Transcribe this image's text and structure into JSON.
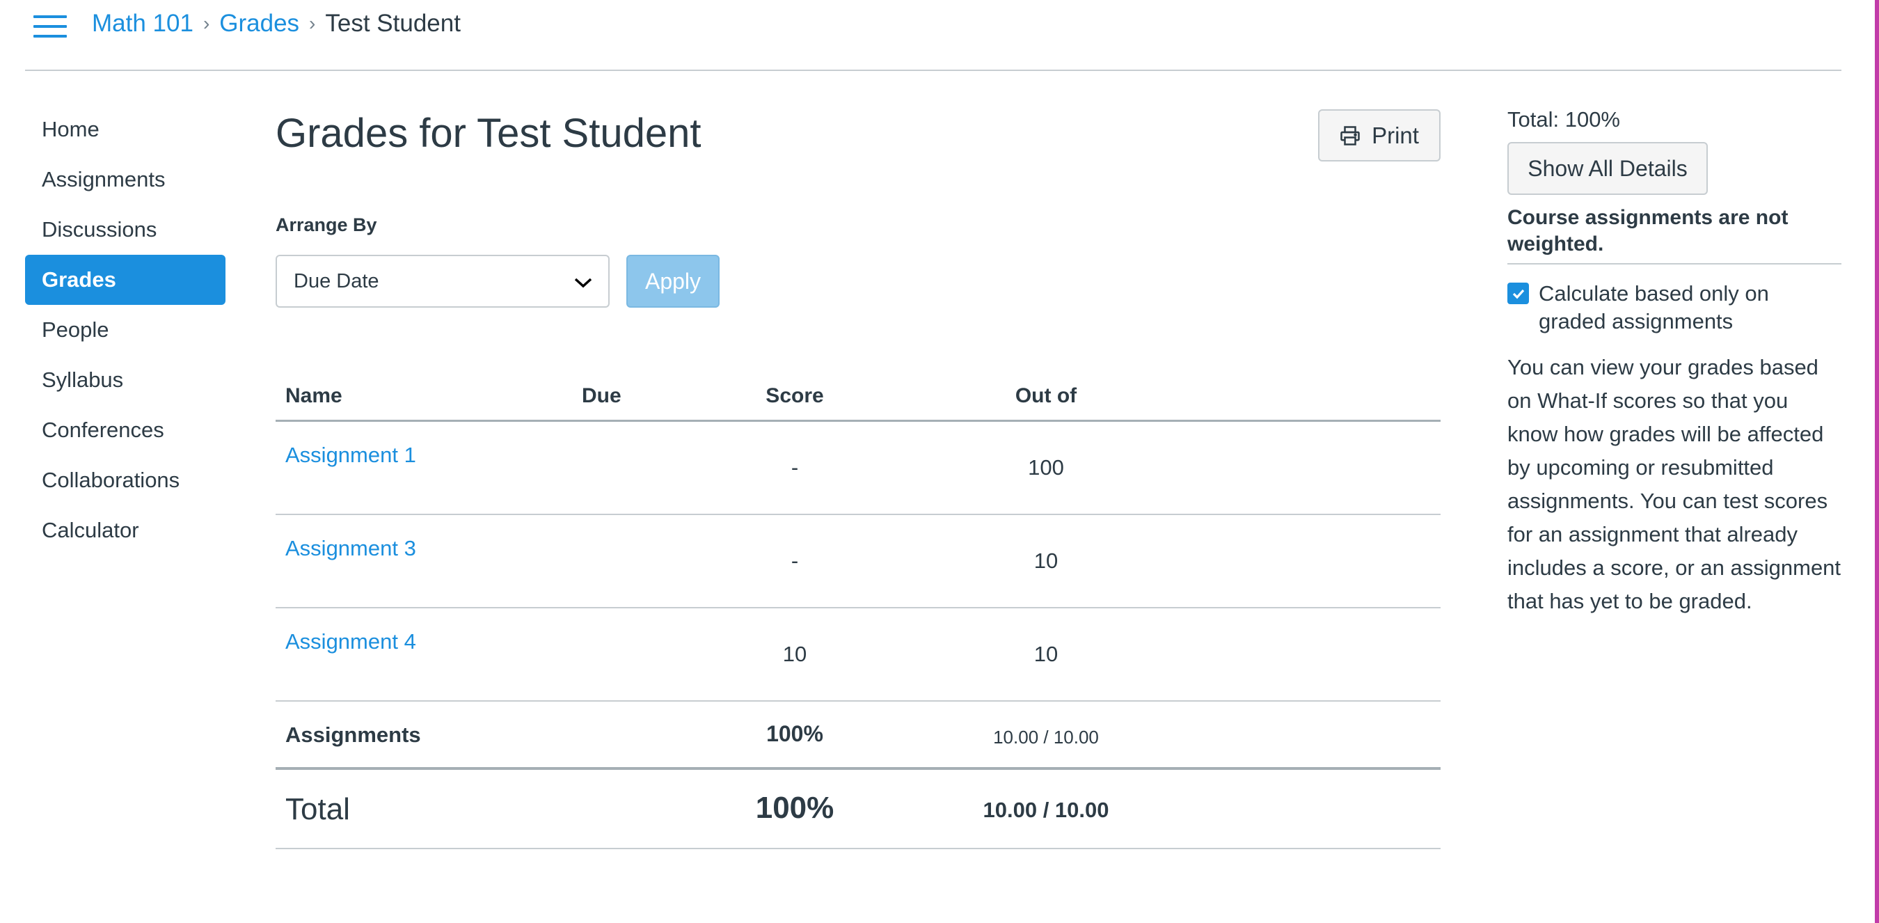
{
  "header": {
    "menu_icon": "hamburger-menu-icon",
    "breadcrumb": [
      {
        "label": "Math 101",
        "link": true
      },
      {
        "label": "Grades",
        "link": true
      },
      {
        "label": "Test Student",
        "link": false
      }
    ],
    "separator": "›"
  },
  "sidebar": {
    "items": [
      {
        "label": "Home",
        "active": false
      },
      {
        "label": "Assignments",
        "active": false
      },
      {
        "label": "Discussions",
        "active": false
      },
      {
        "label": "Grades",
        "active": true
      },
      {
        "label": "People",
        "active": false
      },
      {
        "label": "Syllabus",
        "active": false
      },
      {
        "label": "Conferences",
        "active": false
      },
      {
        "label": "Collaborations",
        "active": false
      },
      {
        "label": "Calculator",
        "active": false
      }
    ]
  },
  "main": {
    "title": "Grades for Test Student",
    "print_label": "Print",
    "print_icon": "printer-icon",
    "arrange_by_label": "Arrange By",
    "arrange_by_value": "Due Date",
    "apply_label": "Apply",
    "table": {
      "headers": {
        "name": "Name",
        "due": "Due",
        "score": "Score",
        "out_of": "Out of"
      },
      "rows": [
        {
          "name": "Assignment 1",
          "due": "",
          "score": "-",
          "out_of": "100"
        },
        {
          "name": "Assignment 3",
          "due": "",
          "score": "-",
          "out_of": "10"
        },
        {
          "name": "Assignment 4",
          "due": "",
          "score": "10",
          "out_of": "10"
        }
      ],
      "group_summary": {
        "label": "Assignments",
        "percent": "100%",
        "points": "10.00 / 10.00"
      },
      "total": {
        "label": "Total",
        "percent": "100%",
        "points": "10.00 / 10.00"
      }
    }
  },
  "right_panel": {
    "total": "Total: 100%",
    "show_details_label": "Show All Details",
    "weight_note": "Course assignments are not weighted.",
    "checkbox_label": "Calculate based only on graded assignments",
    "checkbox_checked": true,
    "whatif_text": "You can view your grades based on What-If scores so that you know how grades will be affected by upcoming or resubmitted assignments. You can test scores for an assignment that already includes a score, or an assignment that has yet to be graded."
  },
  "colors": {
    "brand": "#1b8fde",
    "text": "#2d3b45",
    "border": "#c7cdd1",
    "apply_disabled": "#8dc6ec",
    "edge_accent": "#c13ca9"
  }
}
